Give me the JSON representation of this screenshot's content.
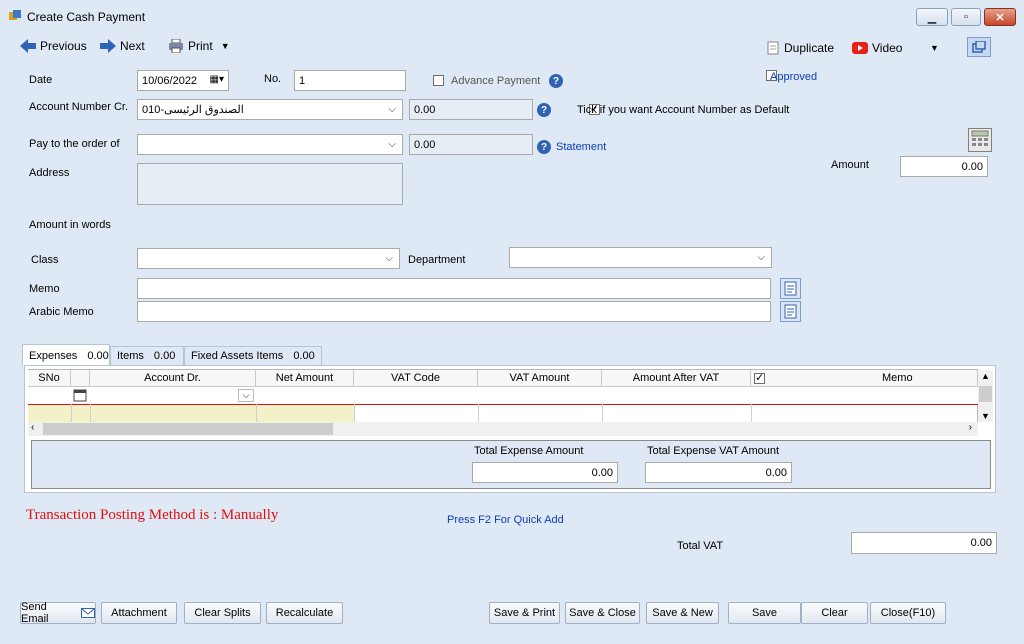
{
  "window": {
    "title": "Create Cash Payment"
  },
  "toolbar": {
    "previous": "Previous",
    "next": "Next",
    "print": "Print",
    "duplicate": "Duplicate",
    "video": "Video"
  },
  "form": {
    "date_label": "Date",
    "date_value": "10/06/2022",
    "no_label": "No.",
    "no_value": "1",
    "advance_payment": "Advance Payment",
    "approved": "Approved",
    "account_number_label": "Account Number Cr.",
    "account_number_value": "الصندوق الرئيسى-010",
    "account_balance": "0.00",
    "default_checkbox": "Tick if you want Account Number as Default",
    "pay_to_label": "Pay to the order of",
    "pay_to_balance": "0.00",
    "statement_link": "Statement",
    "address_label": "Address",
    "amount_label": "Amount",
    "amount_value": "0.00",
    "amount_words_label": "Amount in words",
    "class_label": "Class",
    "department_label": "Department",
    "memo_label": "Memo",
    "arabic_memo_label": "Arabic Memo"
  },
  "tabs": [
    {
      "label": "Expenses",
      "value": "0.00"
    },
    {
      "label": "Items",
      "value": "0.00"
    },
    {
      "label": "Fixed Assets Items",
      "value": "0.00"
    }
  ],
  "grid": {
    "columns": [
      "SNo",
      "Account Dr.",
      "Net Amount",
      "VAT Code",
      "VAT Amount",
      "Amount After VAT",
      "Memo"
    ]
  },
  "totals": {
    "expense_label": "Total Expense Amount",
    "expense_value": "0.00",
    "vat_label": "Total Expense VAT Amount",
    "vat_value": "0.00",
    "total_vat_label": "Total VAT",
    "total_vat_value": "0.00"
  },
  "posting_method": "Transaction Posting Method is : Manually",
  "quick_add_hint": "Press F2 For Quick Add",
  "buttons": {
    "send_email": "Send Email",
    "attachment": "Attachment",
    "clear_splits": "Clear Splits",
    "recalculate": "Recalculate",
    "save_print": "Save & Print",
    "save_close": "Save & Close",
    "save_new": "Save & New",
    "save": "Save",
    "clear": "Clear",
    "close": "Close(F10)"
  },
  "colors": {
    "background": "#dfe9f5",
    "accent_blue": "#2f63b4",
    "posting_red": "#e01010",
    "link_blue": "#0b3cb8",
    "row_yellow": "#f3f1c8"
  }
}
